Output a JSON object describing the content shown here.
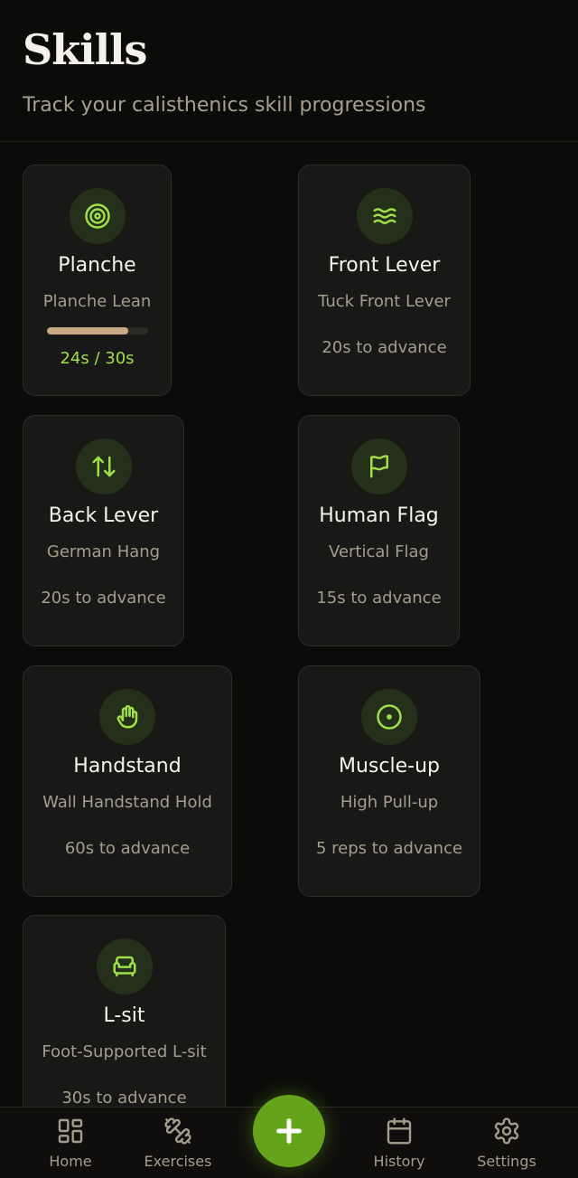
{
  "header": {
    "title": "Skills",
    "subtitle": "Track your calisthenics skill progressions"
  },
  "skills": [
    {
      "name": "Planche",
      "stage": "Planche Lean",
      "icon": "target-icon",
      "progress_text": "24s / 30s",
      "progress_fraction": 0.8
    },
    {
      "name": "Front Lever",
      "stage": "Tuck Front Lever",
      "icon": "waves-icon",
      "advance": "20s to advance"
    },
    {
      "name": "Back Lever",
      "stage": "German Hang",
      "icon": "arrows-up-down-icon",
      "advance": "20s to advance"
    },
    {
      "name": "Human Flag",
      "stage": "Vertical Flag",
      "icon": "flag-icon",
      "advance": "15s to advance"
    },
    {
      "name": "Handstand",
      "stage": "Wall Handstand Hold",
      "icon": "hand-icon",
      "advance": "60s to advance"
    },
    {
      "name": "Muscle-up",
      "stage": "High Pull-up",
      "icon": "circle-dot-icon",
      "advance": "5 reps to advance"
    },
    {
      "name": "L-sit",
      "stage": "Foot-Supported L-sit",
      "icon": "armchair-icon",
      "advance": "30s to advance"
    }
  ],
  "nav": {
    "items": [
      {
        "label": "Home",
        "icon": "grid-icon"
      },
      {
        "label": "Exercises",
        "icon": "dumbbell-icon"
      },
      {
        "label": "History",
        "icon": "calendar-icon"
      },
      {
        "label": "Settings",
        "icon": "gear-icon"
      }
    ],
    "fab_icon": "plus-icon"
  },
  "colors": {
    "accent": "#9fe04a",
    "fab": "#65a41a",
    "progress_fill": "#c9a985",
    "background": "#0b0b0a",
    "card": "#181817"
  }
}
